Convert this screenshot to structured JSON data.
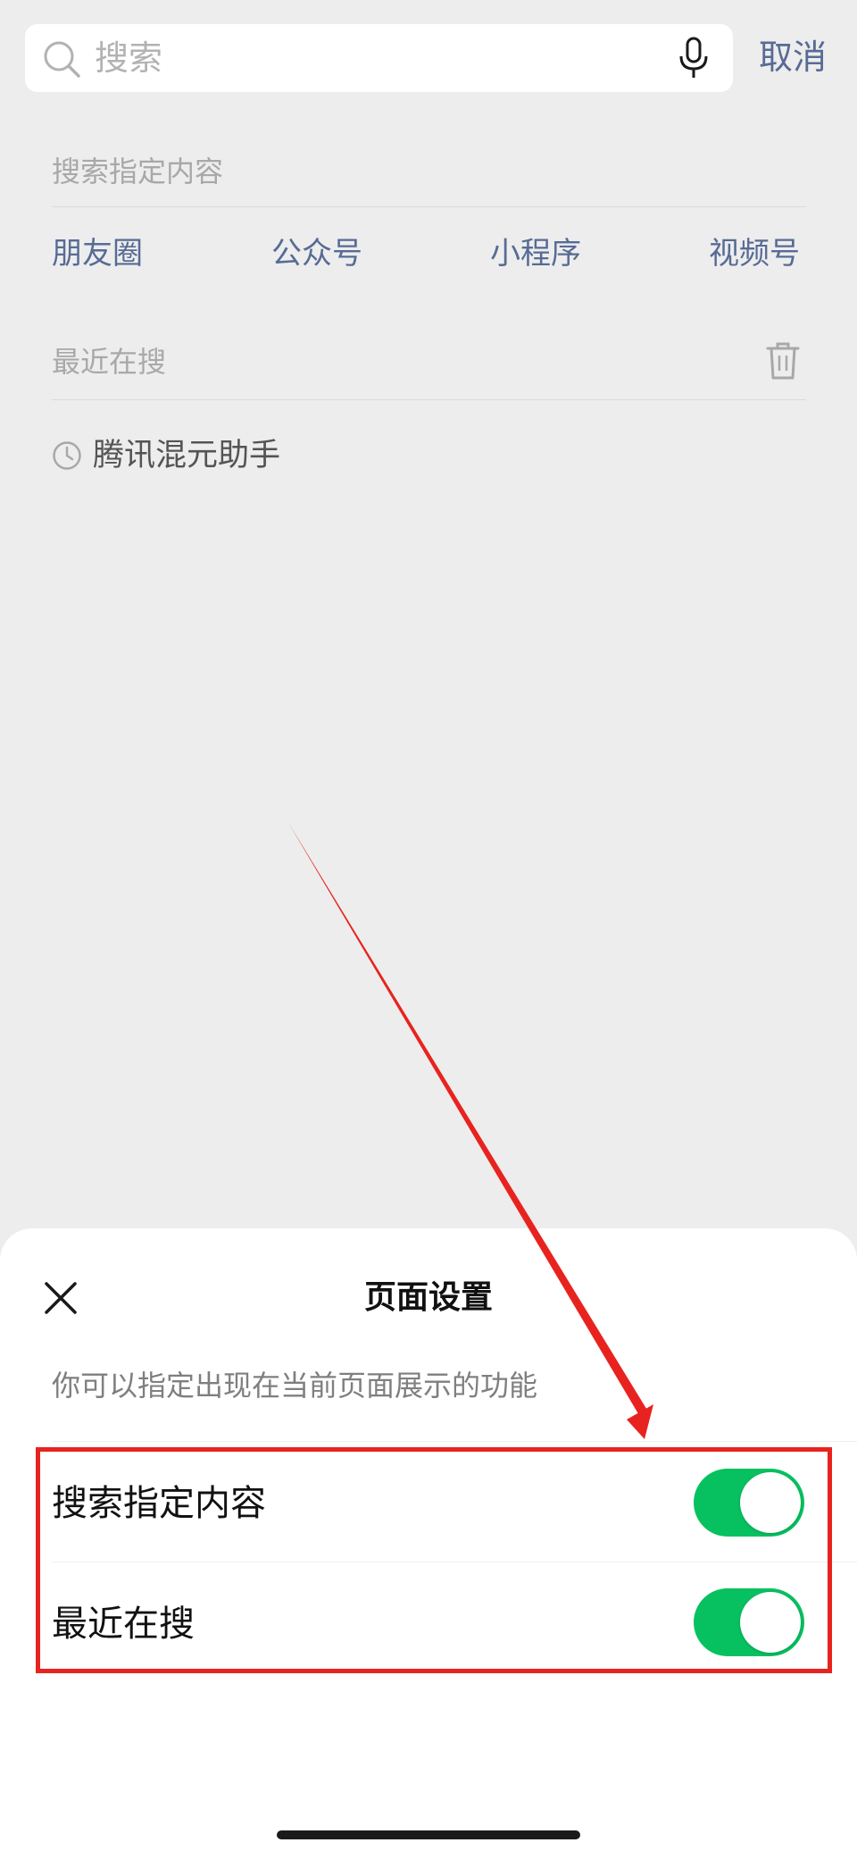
{
  "search": {
    "placeholder": "搜索",
    "cancel_label": "取消"
  },
  "specified_content": {
    "title": "搜索指定内容",
    "categories": [
      "朋友圈",
      "公众号",
      "小程序",
      "视频号"
    ]
  },
  "recent": {
    "title": "最近在搜",
    "items": [
      "腾讯混元助手"
    ]
  },
  "sheet": {
    "title": "页面设置",
    "description": "你可以指定出现在当前页面展示的功能",
    "settings": [
      {
        "label": "搜索指定内容",
        "enabled": true
      },
      {
        "label": "最近在搜",
        "enabled": true
      }
    ]
  },
  "colors": {
    "link": "#576b95",
    "toggle_on": "#07c160",
    "annotation": "#e8231f"
  },
  "icons": [
    "search-icon",
    "microphone-icon",
    "trash-icon",
    "clock-icon",
    "close-icon"
  ]
}
